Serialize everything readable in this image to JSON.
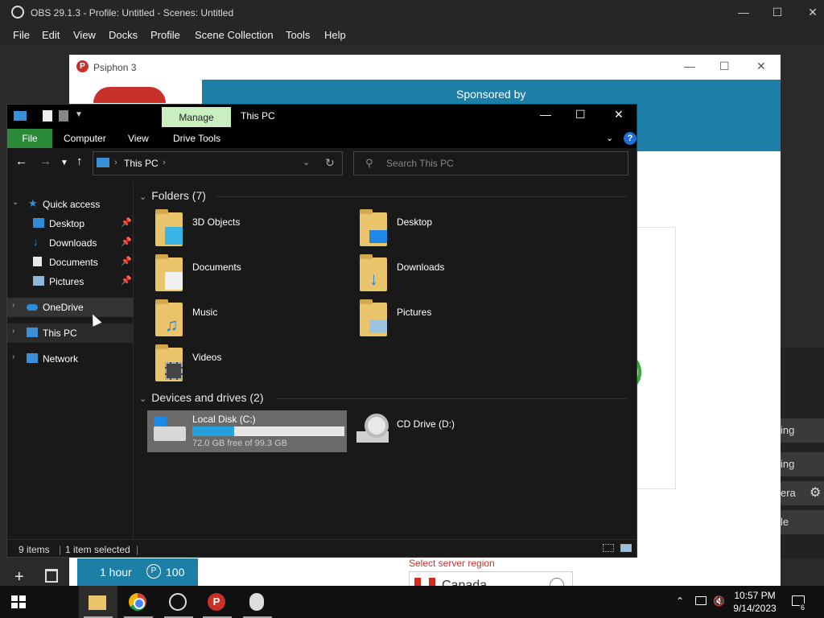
{
  "obs": {
    "title": "OBS 29.1.3 - Profile: Untitled - Scenes: Untitled",
    "menu": [
      "File",
      "Edit",
      "View",
      "Docks",
      "Profile",
      "Scene Collection",
      "Tools",
      "Help"
    ],
    "right_labels": [
      "ing",
      "ing",
      "era",
      "le"
    ]
  },
  "psiphon": {
    "title": "Psiphon 3",
    "banner": "Sponsored by",
    "hour_label": "1 hour",
    "coin_symbol": "P",
    "points": "100",
    "region_label": "Select server region",
    "region_value": "Canada"
  },
  "explorer": {
    "title": "This PC",
    "manage_tab": "Manage",
    "tabs": {
      "file": "File",
      "computer": "Computer",
      "view": "View",
      "drive_tools": "Drive Tools"
    },
    "help": "?",
    "address": {
      "location": "This PC"
    },
    "search": {
      "placeholder": "Search This PC"
    },
    "nav": {
      "quick_access": "Quick access",
      "desktop": "Desktop",
      "downloads": "Downloads",
      "documents": "Documents",
      "pictures": "Pictures",
      "onedrive": "OneDrive",
      "this_pc": "This PC",
      "network": "Network"
    },
    "groups": {
      "folders": "Folders (7)",
      "devices": "Devices and drives (2)"
    },
    "folders": [
      "3D Objects",
      "Desktop",
      "Documents",
      "Downloads",
      "Music",
      "Pictures",
      "Videos"
    ],
    "drives": {
      "c": {
        "name": "Local Disk (C:)",
        "free": "72.0 GB free of 99.3 GB",
        "used_fraction": 0.275
      },
      "d": {
        "name": "CD Drive (D:)"
      }
    },
    "status": {
      "items": "9 items",
      "selected": "1 item selected"
    }
  },
  "taskbar": {
    "time": "10:57 PM",
    "date": "9/14/2023",
    "notifications": "6"
  },
  "colors": {
    "accent_green": "#2a8a3a",
    "manage_tab": "#c9efc0",
    "psiphon_blue": "#1d7ea6",
    "drive_bar": "#26a0da"
  }
}
